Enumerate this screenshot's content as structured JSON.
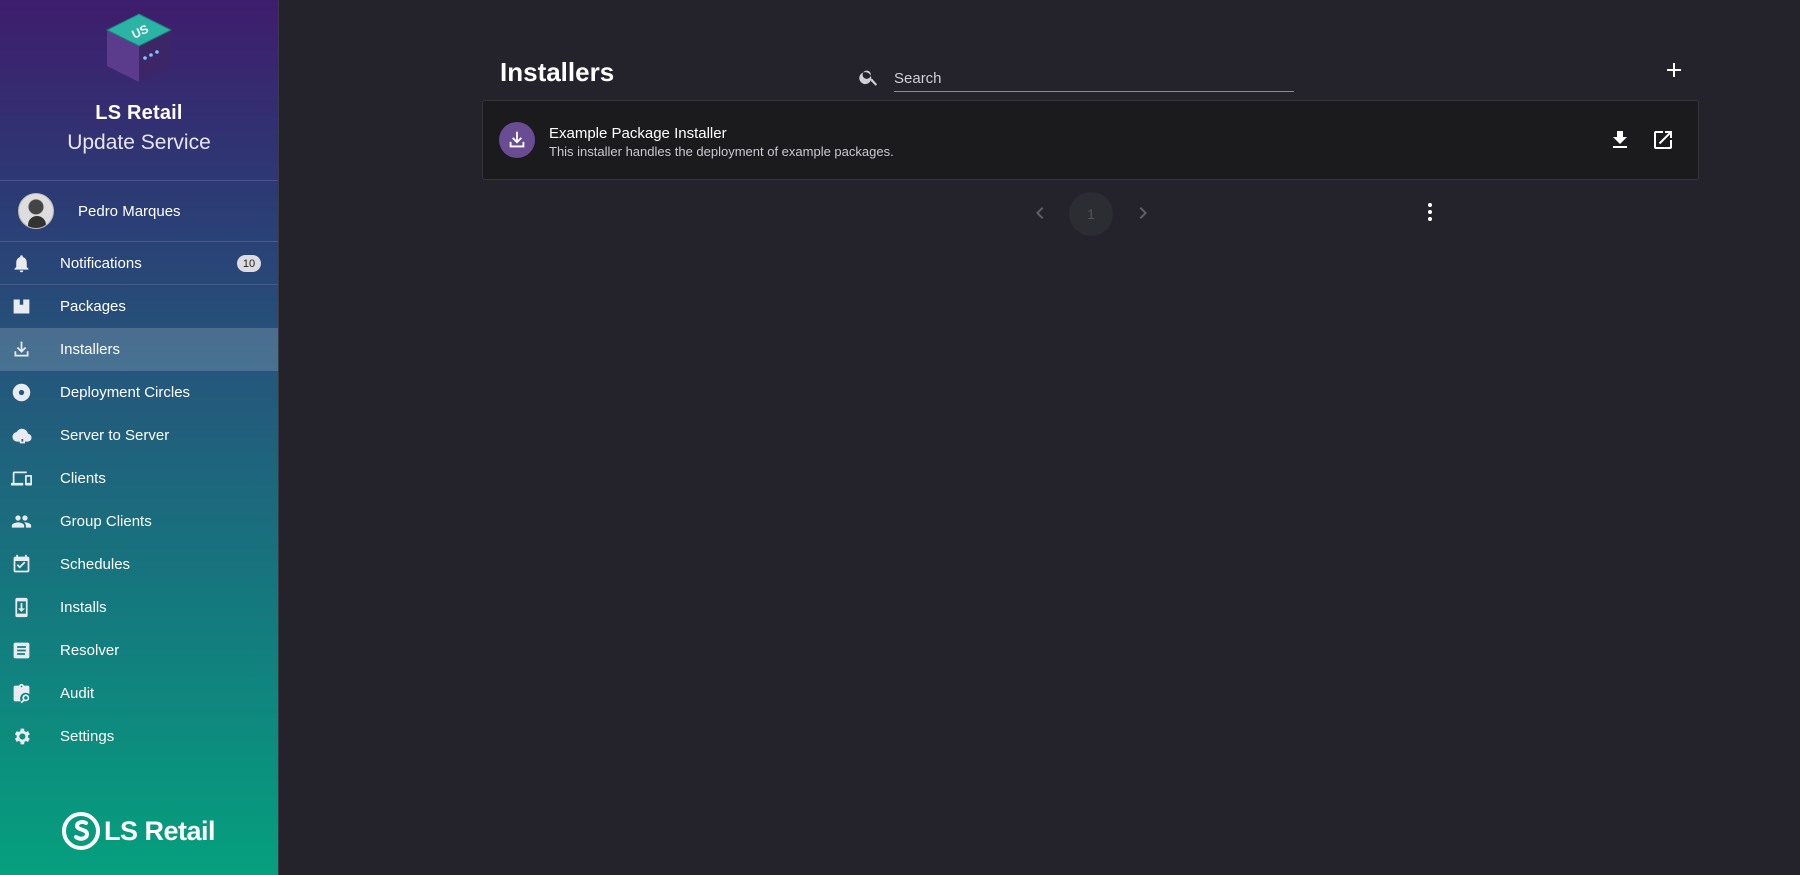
{
  "brand": {
    "title": "LS Retail",
    "subtitle": "Update Service",
    "cube_text": "US",
    "footer_logo": "LS Retail"
  },
  "user": {
    "name": "Pedro Marques"
  },
  "sidebar": {
    "items": [
      {
        "label": "Notifications",
        "icon": "bell-icon",
        "badge": "10"
      },
      {
        "label": "Packages",
        "icon": "package-icon"
      },
      {
        "label": "Installers",
        "icon": "download-icon",
        "active": true
      },
      {
        "label": "Deployment Circles",
        "icon": "disc-icon"
      },
      {
        "label": "Server to Server",
        "icon": "cloud-icon"
      },
      {
        "label": "Clients",
        "icon": "devices-icon"
      },
      {
        "label": "Group Clients",
        "icon": "group-icon"
      },
      {
        "label": "Schedules",
        "icon": "calendar-check-icon"
      },
      {
        "label": "Installs",
        "icon": "install-device-icon"
      },
      {
        "label": "Resolver",
        "icon": "document-icon"
      },
      {
        "label": "Audit",
        "icon": "audit-icon"
      },
      {
        "label": "Settings",
        "icon": "gear-icon"
      }
    ]
  },
  "main": {
    "title": "Installers",
    "search": {
      "placeholder": "Search",
      "value": ""
    },
    "installers": [
      {
        "name": "Example Package Installer",
        "description": "This installer handles the deployment of example packages."
      }
    ],
    "pagination": {
      "current_page": "1"
    }
  },
  "colors": {
    "background": "#24232b",
    "card": "#1b1b1d",
    "accent_purple": "#6a4c93",
    "sidebar_top": "#3e1d6e",
    "sidebar_bottom": "#05a07e"
  }
}
